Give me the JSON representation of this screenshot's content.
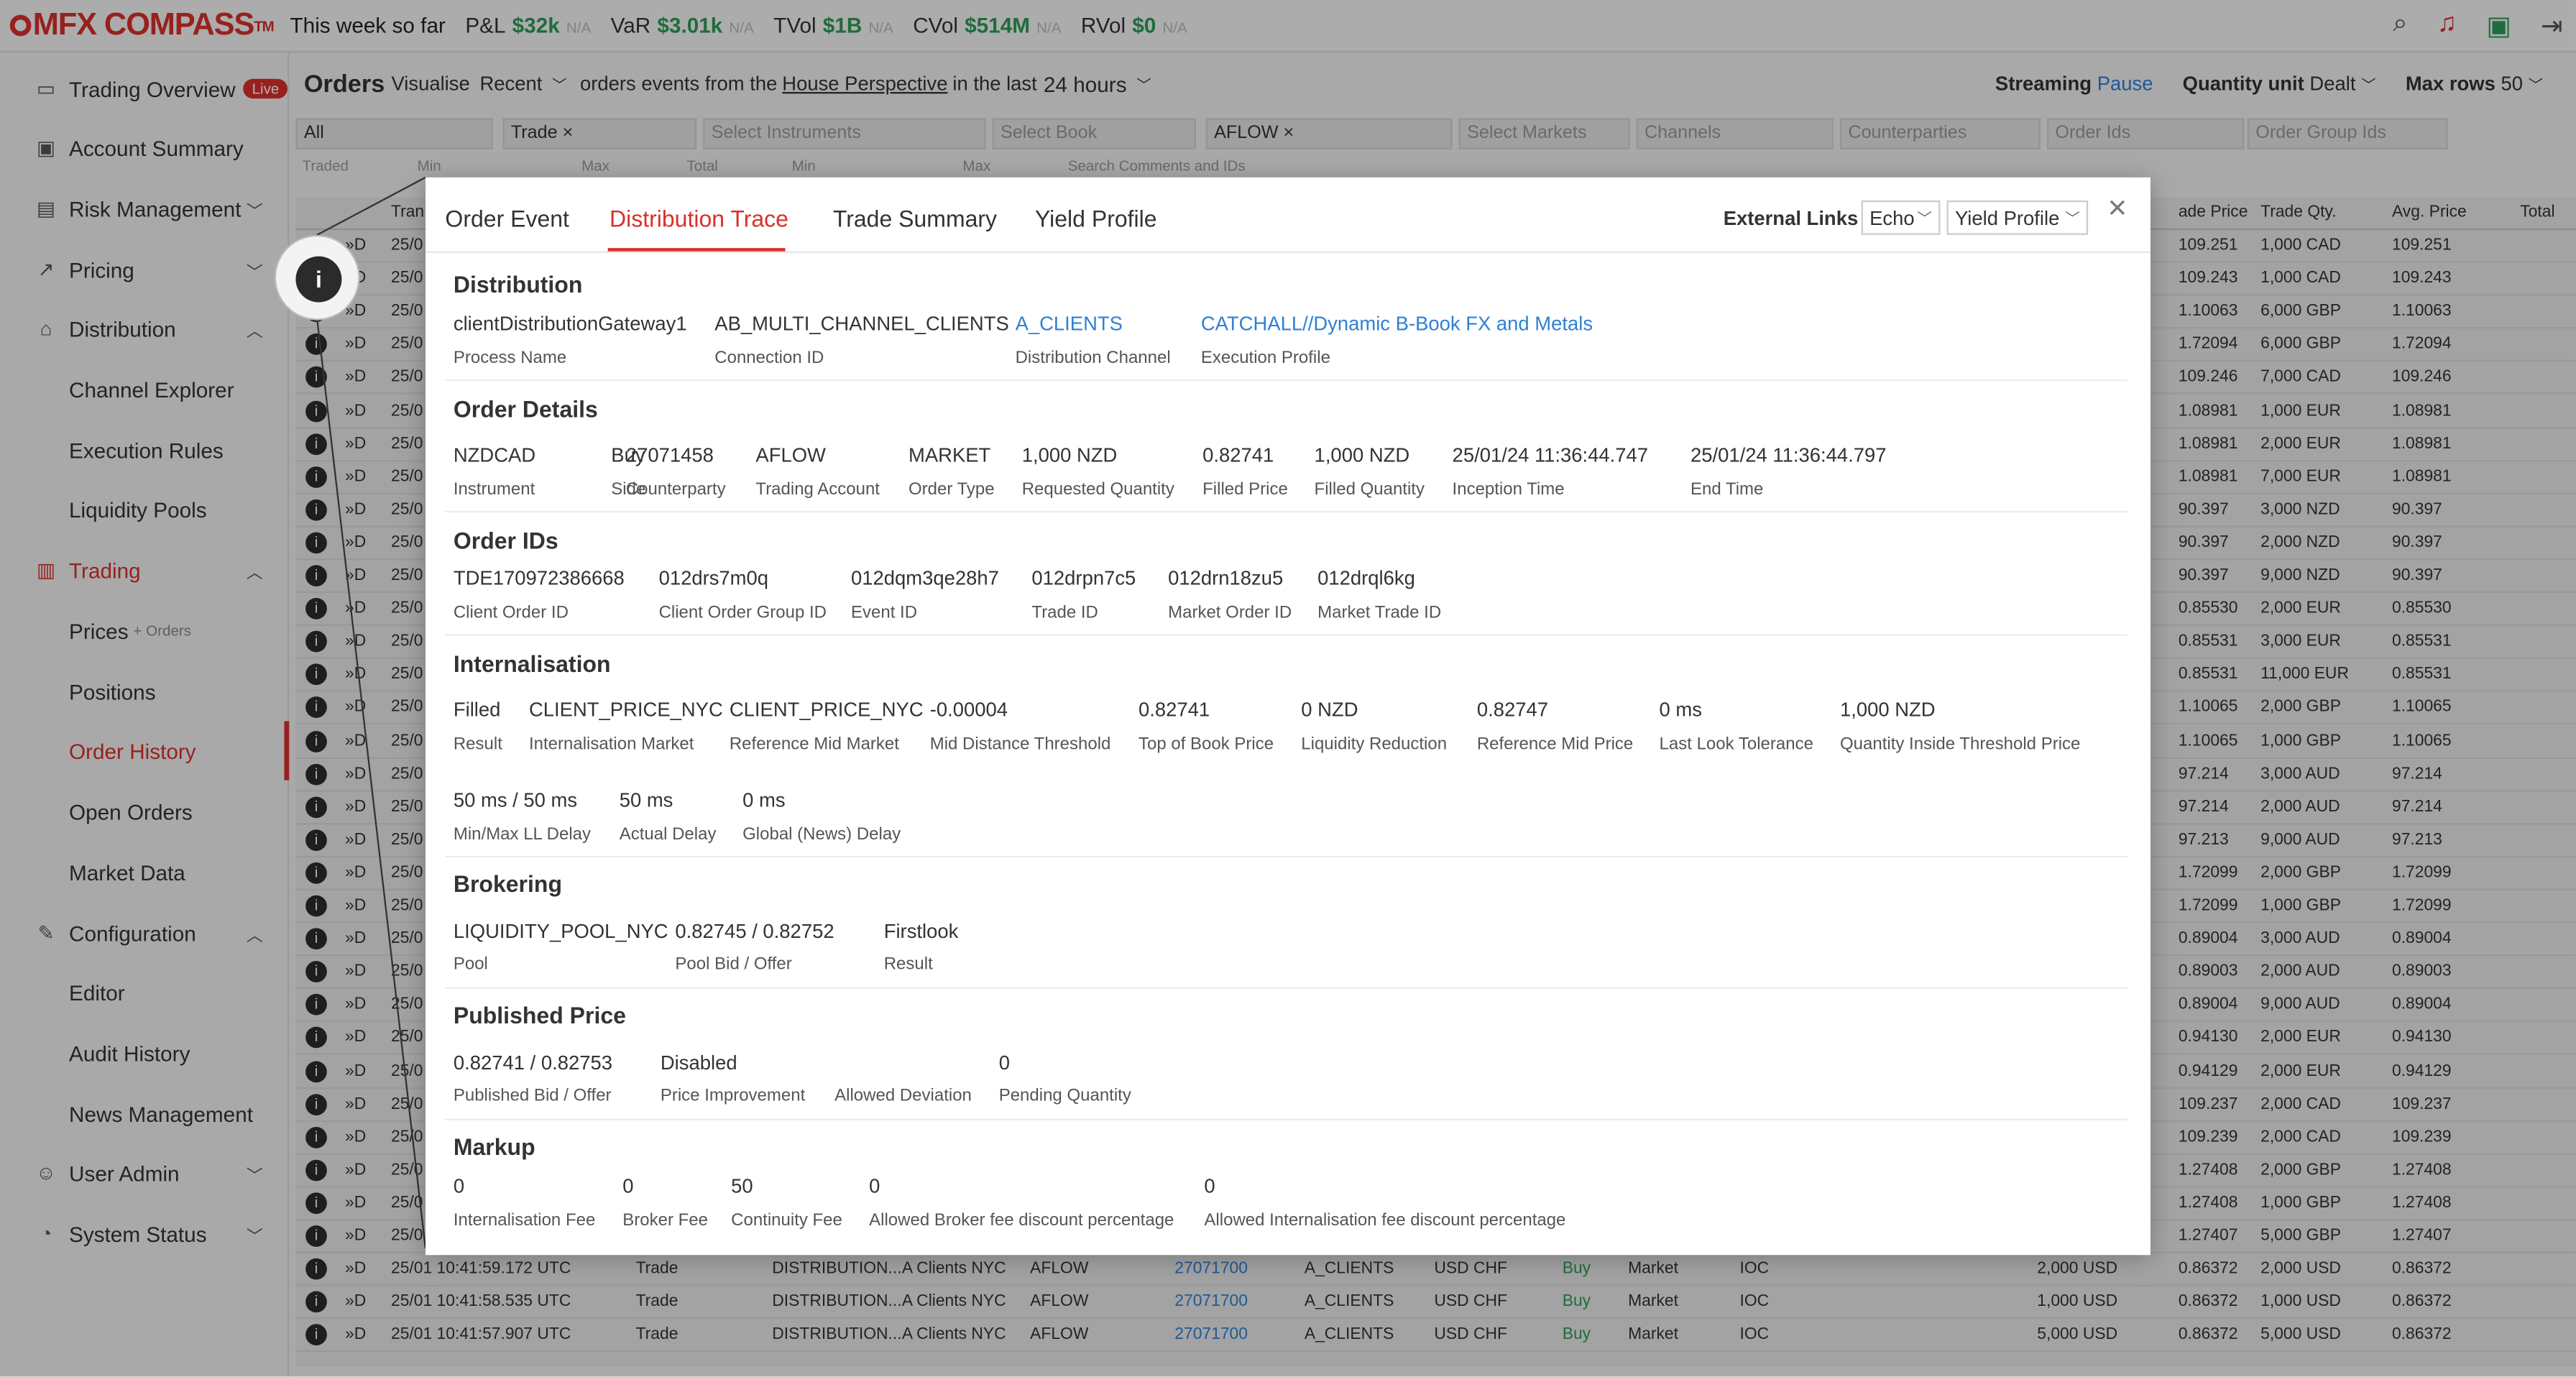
{
  "app": {
    "logo": "MFX COMPASS",
    "tm": "TM",
    "week": "This week so far"
  },
  "kpis": [
    {
      "label": "P&L",
      "value": "$32k",
      "na": "N/A"
    },
    {
      "label": "VaR",
      "value": "$3.01k",
      "na": "N/A"
    },
    {
      "label": "TVol",
      "value": "$1B",
      "na": "N/A"
    },
    {
      "label": "CVol",
      "value": "$514M",
      "na": "N/A"
    },
    {
      "label": "RVol",
      "value": "$0",
      "na": "N/A"
    }
  ],
  "sidebar": {
    "items": [
      {
        "label": "Trading Overview",
        "badge": "Live"
      },
      {
        "label": "Account Summary"
      },
      {
        "label": "Risk Management"
      },
      {
        "label": "Pricing"
      },
      {
        "label": "Distribution"
      },
      {
        "label": "Channel Explorer"
      },
      {
        "label": "Execution Rules"
      },
      {
        "label": "Liquidity Pools"
      },
      {
        "label": "Trading"
      },
      {
        "label": "Prices",
        "extra": "+ Orders"
      },
      {
        "label": "Positions"
      },
      {
        "label": "Order History"
      },
      {
        "label": "Open Orders"
      },
      {
        "label": "Market Data"
      },
      {
        "label": "Configuration"
      },
      {
        "label": "Editor"
      },
      {
        "label": "Audit History"
      },
      {
        "label": "News Management"
      },
      {
        "label": "User Admin"
      },
      {
        "label": "System Status"
      }
    ]
  },
  "orders": {
    "title": "Orders",
    "visualise": "Visualise",
    "recent": "Recent",
    "desc1": "orders events from the",
    "perspective": "House Perspective",
    "desc2": "in the last",
    "hours": "24 hours",
    "streaming": "Streaming",
    "pause": "Pause",
    "qunit": "Quantity unit",
    "dealt": "Dealt",
    "maxrows": "Max rows",
    "maxval": "50"
  },
  "filters": {
    "all": "All",
    "trade": "Trade",
    "instr": "Select Instruments",
    "book": "Select Book",
    "aflow": "AFLOW",
    "markets": "Select Markets",
    "channels": "Channels",
    "cps": "Counterparties",
    "oids": "Order Ids",
    "ogids": "Order Group Ids",
    "traded": "Traded",
    "min": "Min",
    "max": "Max",
    "total": "Total",
    "search": "Search Comments and IDs"
  },
  "table": {
    "headers": {
      "trans": "Tran",
      "price": "ade Price",
      "qty": "Trade Qty.",
      "avg": "Avg. Price",
      "total": "Total"
    },
    "rows": [
      [
        "25/0",
        "109.251",
        "1,000 CAD",
        "109.251"
      ],
      [
        "25/0",
        "109.243",
        "1,000 CAD",
        "109.243"
      ],
      [
        "25/0",
        "1.10063",
        "6,000 GBP",
        "1.10063"
      ],
      [
        "25/0",
        "1.72094",
        "6,000 GBP",
        "1.72094"
      ],
      [
        "25/0",
        "109.246",
        "7,000 CAD",
        "109.246"
      ],
      [
        "25/0",
        "1.08981",
        "1,000 EUR",
        "1.08981"
      ],
      [
        "25/0",
        "1.08981",
        "2,000 EUR",
        "1.08981"
      ],
      [
        "25/0",
        "1.08981",
        "7,000 EUR",
        "1.08981"
      ],
      [
        "25/0",
        "90.397",
        "3,000 NZD",
        "90.397"
      ],
      [
        "25/0",
        "90.397",
        "2,000 NZD",
        "90.397"
      ],
      [
        "25/0",
        "90.397",
        "9,000 NZD",
        "90.397"
      ],
      [
        "25/0",
        "0.85530",
        "2,000 EUR",
        "0.85530"
      ],
      [
        "25/0",
        "0.85531",
        "3,000 EUR",
        "0.85531"
      ],
      [
        "25/0",
        "0.85531",
        "11,000 EUR",
        "0.85531"
      ],
      [
        "25/0",
        "1.10065",
        "2,000 GBP",
        "1.10065"
      ],
      [
        "25/0",
        "1.10065",
        "1,000 GBP",
        "1.10065"
      ],
      [
        "25/0",
        "97.214",
        "3,000 AUD",
        "97.214"
      ],
      [
        "25/0",
        "97.214",
        "2,000 AUD",
        "97.214"
      ],
      [
        "25/0",
        "97.213",
        "9,000 AUD",
        "97.213"
      ],
      [
        "25/0",
        "1.72099",
        "2,000 GBP",
        "1.72099"
      ],
      [
        "25/0",
        "1.72099",
        "1,000 GBP",
        "1.72099"
      ],
      [
        "25/0",
        "0.89004",
        "3,000 AUD",
        "0.89004"
      ],
      [
        "25/0",
        "0.89003",
        "2,000 AUD",
        "0.89003"
      ],
      [
        "25/0",
        "0.89004",
        "9,000 AUD",
        "0.89004"
      ],
      [
        "25/0",
        "0.94130",
        "2,000 EUR",
        "0.94130"
      ],
      [
        "25/0",
        "0.94129",
        "2,000 EUR",
        "0.94129"
      ],
      [
        "25/0",
        "109.237",
        "2,000 CAD",
        "109.237"
      ],
      [
        "25/0",
        "109.239",
        "2,000 CAD",
        "109.239"
      ],
      [
        "25/0",
        "1.27408",
        "2,000 GBP",
        "1.27408"
      ],
      [
        "25/0",
        "1.27408",
        "1,000 GBP",
        "1.27408"
      ],
      [
        "25/0",
        "1.27407",
        "5,000 GBP",
        "1.27407"
      ]
    ],
    "fullrows": [
      [
        "25/01 10:41:59.172 UTC",
        "Trade",
        "DISTRIBUTION...",
        "A Clients NYC",
        "AFLOW",
        "27071700",
        "A_CLIENTS",
        "USD CHF",
        "Buy",
        "Market",
        "IOC",
        "2,000 USD",
        "0.86372",
        "2,000 USD",
        "0.86372"
      ],
      [
        "25/01 10:41:58.535 UTC",
        "Trade",
        "DISTRIBUTION...",
        "A Clients NYC",
        "AFLOW",
        "27071700",
        "A_CLIENTS",
        "USD CHF",
        "Buy",
        "Market",
        "IOC",
        "1,000 USD",
        "0.86372",
        "1,000 USD",
        "0.86372"
      ],
      [
        "25/01 10:41:57.907 UTC",
        "Trade",
        "DISTRIBUTION...",
        "A Clients NYC",
        "AFLOW",
        "27071700",
        "A_CLIENTS",
        "USD CHF",
        "Buy",
        "Market",
        "IOC",
        "5,000 USD",
        "0.86372",
        "5,000 USD",
        "0.86372"
      ]
    ]
  },
  "modal": {
    "tabs": [
      "Order Event",
      "Distribution Trace",
      "Trade Summary",
      "Yield Profile"
    ],
    "ext": "External Links",
    "echo": "Echo",
    "yp": "Yield Profile",
    "distribution": {
      "title": "Distribution",
      "v": [
        "clientDistributionGateway1",
        "AB_MULTI_CHANNEL_CLIENTS",
        "A_CLIENTS",
        "CATCHALL//Dynamic B-Book FX and Metals"
      ],
      "l": [
        "Process Name",
        "Connection ID",
        "Distribution Channel",
        "Execution Profile"
      ]
    },
    "details": {
      "title": "Order Details",
      "v": [
        "NZDCAD",
        "Buy",
        "27071458",
        "AFLOW",
        "MARKET",
        "1,000 NZD",
        "0.82741",
        "1,000 NZD",
        "25/01/24 11:36:44.747",
        "25/01/24 11:36:44.797"
      ],
      "l": [
        "Instrument",
        "Side",
        "Counterparty",
        "Trading Account",
        "Order Type",
        "Requested Quantity",
        "Filled Price",
        "Filled Quantity",
        "Inception Time",
        "End Time"
      ]
    },
    "ids": {
      "title": "Order IDs",
      "v": [
        "TDE170972386668",
        "012drs7m0q",
        "012dqm3qe28h7",
        "012drpn7c5",
        "012drn18zu5",
        "012drql6kg"
      ],
      "l": [
        "Client Order ID",
        "Client Order Group ID",
        "Event ID",
        "Trade ID",
        "Market Order ID",
        "Market Trade ID"
      ]
    },
    "intern": {
      "title": "Internalisation",
      "v": [
        "Filled",
        "CLIENT_PRICE_NYC",
        "CLIENT_PRICE_NYC",
        "-0.00004",
        "0.82741",
        "0 NZD",
        "0.82747",
        "0 ms",
        "1,000 NZD"
      ],
      "l": [
        "Result",
        "Internalisation Market",
        "Reference Mid Market",
        "Mid Distance Threshold",
        "Top of Book Price",
        "Liquidity Reduction",
        "Reference Mid Price",
        "Last Look Tolerance",
        "Quantity Inside Threshold Price"
      ],
      "v2": [
        "50 ms / 50 ms",
        "50 ms",
        "0 ms"
      ],
      "l2": [
        "Min/Max LL Delay",
        "Actual Delay",
        "Global (News) Delay"
      ]
    },
    "brok": {
      "title": "Brokering",
      "v": [
        "LIQUIDITY_POOL_NYC",
        "0.82745 / 0.82752",
        "Firstlook"
      ],
      "l": [
        "Pool",
        "Pool Bid / Offer",
        "Result"
      ]
    },
    "pub": {
      "title": "Published Price",
      "v": [
        "0.82741 / 0.82753",
        "Disabled",
        "",
        "0"
      ],
      "l": [
        "Published Bid / Offer",
        "Price Improvement",
        "Allowed Deviation",
        "Pending Quantity"
      ]
    },
    "markup": {
      "title": "Markup",
      "v": [
        "0",
        "0",
        "50",
        "0",
        "0"
      ],
      "l": [
        "Internalisation Fee",
        "Broker Fee",
        "Continuity Fee",
        "Allowed Broker fee discount percentage",
        "Allowed Internalisation fee discount percentage"
      ]
    }
  }
}
